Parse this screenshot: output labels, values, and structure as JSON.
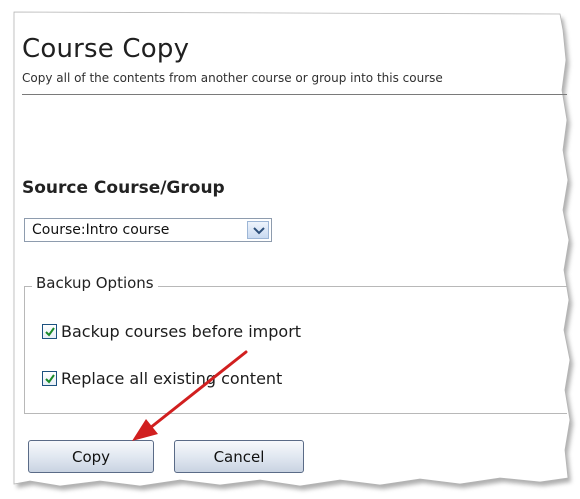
{
  "page": {
    "title": "Course Copy",
    "subtitle": "Copy all of the contents from another course or group into this course"
  },
  "source": {
    "heading": "Source Course/Group",
    "selected": "Course:Intro course"
  },
  "backup": {
    "legend": "Backup Options",
    "options": [
      {
        "label": "Backup courses before import",
        "checked": true
      },
      {
        "label": "Replace all existing content",
        "checked": true
      }
    ]
  },
  "buttons": {
    "copy": "Copy",
    "cancel": "Cancel"
  },
  "colors": {
    "annotation_arrow": "#d11f1f",
    "checkmark": "#1a8a2a",
    "button_border": "#5a6b87"
  },
  "icons": {
    "dropdown": "chevron-down-icon",
    "check": "checkmark-icon"
  }
}
